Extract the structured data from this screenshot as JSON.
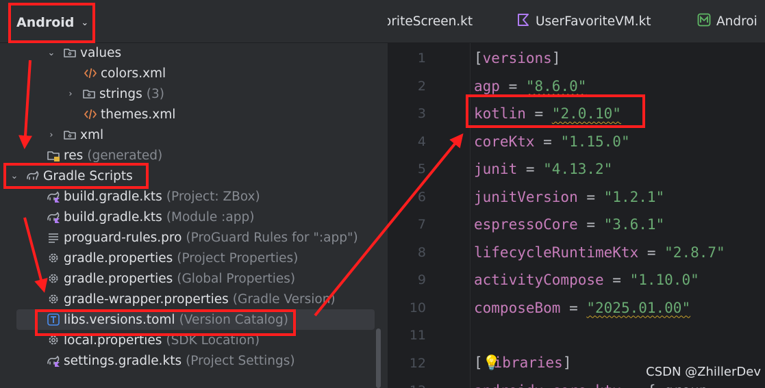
{
  "left_panel": {
    "view_selector": "Android",
    "tree": [
      {
        "name": "values",
        "hint": "",
        "icon": "folder-icon",
        "expand": "open"
      },
      {
        "name": "colors.xml",
        "hint": "",
        "icon": "xml-file-icon",
        "expand": ""
      },
      {
        "name": "strings",
        "hint": "(3)",
        "icon": "folder-icon",
        "expand": "closed"
      },
      {
        "name": "themes.xml",
        "hint": "",
        "icon": "xml-file-icon",
        "expand": ""
      },
      {
        "name": "xml",
        "hint": "",
        "icon": "folder-icon",
        "expand": "closed"
      },
      {
        "name": "res",
        "hint": "(generated)",
        "icon": "generated-folder-icon",
        "expand": ""
      },
      {
        "name": "Gradle Scripts",
        "hint": "",
        "icon": "gradle-elephant-icon",
        "expand": "open"
      },
      {
        "name": "build.gradle.kts",
        "hint": "(Project: ZBox)",
        "icon": "gradle-kts-icon",
        "expand": ""
      },
      {
        "name": "build.gradle.kts",
        "hint": "(Module :app)",
        "icon": "gradle-kts-icon",
        "expand": ""
      },
      {
        "name": "proguard-rules.pro",
        "hint": "(ProGuard Rules for \":app\")",
        "icon": "text-file-icon",
        "expand": ""
      },
      {
        "name": "gradle.properties",
        "hint": "(Project Properties)",
        "icon": "gear-icon",
        "expand": ""
      },
      {
        "name": "gradle.properties",
        "hint": "(Global Properties)",
        "icon": "gear-icon",
        "expand": ""
      },
      {
        "name": "gradle-wrapper.properties",
        "hint": "(Gradle Version)",
        "icon": "gear-icon",
        "expand": ""
      },
      {
        "name": "libs.versions.toml",
        "hint": "(Version Catalog)",
        "icon": "toml-file-icon",
        "expand": ""
      },
      {
        "name": "local.properties",
        "hint": "(SDK Location)",
        "icon": "gear-icon",
        "expand": ""
      },
      {
        "name": "settings.gradle.kts",
        "hint": "(Project Settings)",
        "icon": "gradle-kts-icon",
        "expand": ""
      }
    ]
  },
  "editor": {
    "tabs": [
      {
        "label": "oriteScreen.kt",
        "icon": ""
      },
      {
        "label": "UserFavoriteVM.kt",
        "icon": "kotlin-file-icon"
      },
      {
        "label": "Androi",
        "icon": "manifest-icon"
      }
    ],
    "lines": [
      {
        "n": "1",
        "key": "[versions]",
        "eq": "",
        "val": ""
      },
      {
        "n": "2",
        "key": "agp",
        "eq": " = ",
        "val": "\"8.6.0\""
      },
      {
        "n": "3",
        "key": "kotlin",
        "eq": " = ",
        "val": "\"2.0.10\""
      },
      {
        "n": "4",
        "key": "coreKtx",
        "eq": " = ",
        "val": "\"1.15.0\""
      },
      {
        "n": "5",
        "key": "junit",
        "eq": " = ",
        "val": "\"4.13.2\""
      },
      {
        "n": "6",
        "key": "junitVersion",
        "eq": " = ",
        "val": "\"1.2.1\""
      },
      {
        "n": "7",
        "key": "espressoCore",
        "eq": " = ",
        "val": "\"3.6.1\""
      },
      {
        "n": "8",
        "key": "lifecycleRuntimeKtx",
        "eq": " = ",
        "val": "\"2.8.7\""
      },
      {
        "n": "9",
        "key": "activityCompose",
        "eq": " = ",
        "val": "\"1.10.0\""
      },
      {
        "n": "10",
        "key": "composeBom",
        "eq": " = ",
        "val": "\"2025.01.00\""
      },
      {
        "n": "11",
        "key": "",
        "eq": "",
        "val": ""
      },
      {
        "n": "12",
        "key": "[libraries]",
        "eq": "",
        "val": ""
      },
      {
        "n": "13",
        "key": "androidx-core-ktx",
        "eq": " = { group ",
        "val": ""
      }
    ]
  },
  "watermark": "CSDN @ZhillerDev",
  "colors": {
    "annotation_red": "#ff1e1e",
    "key_purple": "#c77dbb",
    "string_green": "#6aab73"
  }
}
